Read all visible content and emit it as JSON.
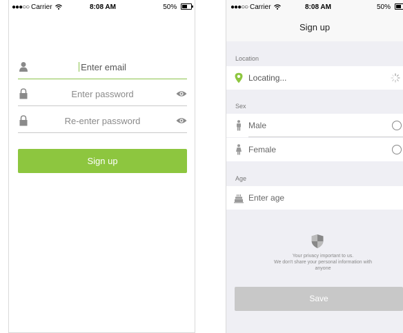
{
  "status_bar": {
    "signal_dots": "●●●○○",
    "carrier": "Carrier",
    "time": "8:08 AM",
    "battery_percent": "50%"
  },
  "signup_form": {
    "email_placeholder": "Enter email",
    "password_placeholder": "Enter password",
    "reenter_password_placeholder": "Re-enter password",
    "signup_button_label": "Sign up",
    "accent_color": "#8dc63f"
  },
  "profile_form": {
    "title": "Sign up",
    "location_section": "Location",
    "location_value": "Locating...",
    "sex_section": "Sex",
    "sex_options": [
      "Male",
      "Female"
    ],
    "age_section": "Age",
    "age_placeholder": "Enter age",
    "privacy_line1": "Your privacy important to us.",
    "privacy_line2": "We don't share your personal information with",
    "privacy_line3": "anyone",
    "save_button_label": "Save",
    "save_button_color": "#c8c8c8"
  }
}
